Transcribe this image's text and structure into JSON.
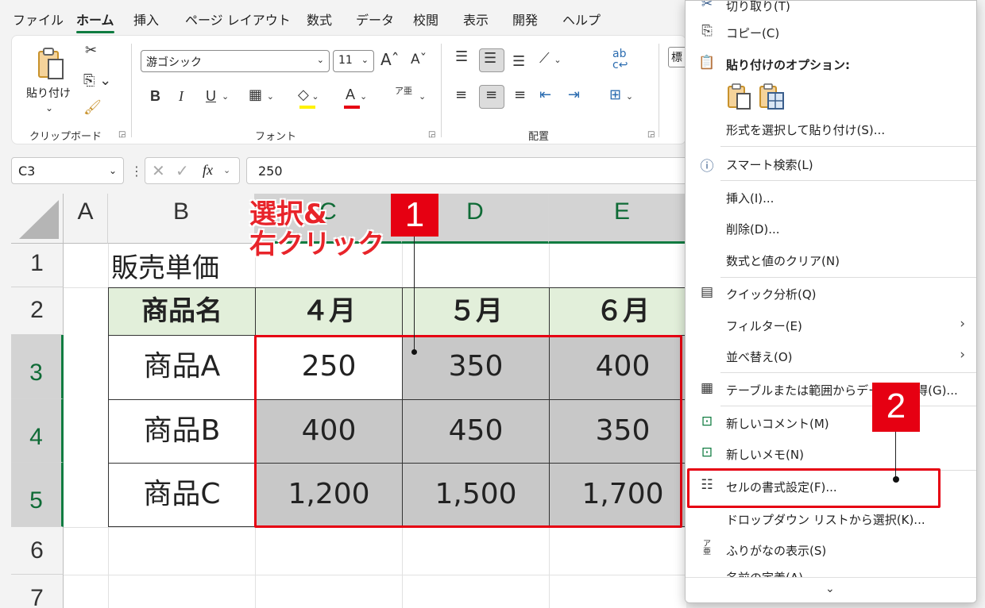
{
  "tabs": [
    "ファイル",
    "ホーム",
    "挿入",
    "ページ レイアウト",
    "数式",
    "データ",
    "校閲",
    "表示",
    "開発",
    "ヘルプ"
  ],
  "ribbon": {
    "paste_label": "貼り付け",
    "clipboard_group": "クリップボード",
    "font_name": "游ゴシック",
    "font_size": "11",
    "font_group": "フォント",
    "align_group": "配置",
    "bold": "B",
    "italic": "I",
    "underline": "U",
    "font_color_letter": "A",
    "furigana_glyph": "ア亜",
    "number_format_partial": "標"
  },
  "formula_bar": {
    "name_box": "C3",
    "fx": "fx",
    "value": "250"
  },
  "grid": {
    "columns": [
      "A",
      "B",
      "C",
      "D",
      "E"
    ],
    "rows": [
      "1",
      "2",
      "3",
      "4",
      "5",
      "6",
      "7"
    ],
    "title": "販売単価",
    "headers": [
      "商品名",
      "４月",
      "５月",
      "６月"
    ],
    "data": [
      [
        "商品A",
        "250",
        "350",
        "400"
      ],
      [
        "商品B",
        "400",
        "450",
        "350"
      ],
      [
        "商品C",
        "1,200",
        "1,500",
        "1,700"
      ]
    ]
  },
  "annotations": {
    "step1_text_line1": "選択&",
    "step1_text_line2": "右クリック",
    "badge1": "1",
    "badge2": "2"
  },
  "context_menu": {
    "cut_partial": "切り取り(T)",
    "copy": "コピー(C)",
    "paste_options": "貼り付けのオプション:",
    "paste_special": "形式を選択して貼り付け(S)...",
    "smart_lookup": "スマート検索(L)",
    "insert": "挿入(I)...",
    "delete": "削除(D)...",
    "clear": "数式と値のクリア(N)",
    "quick_analysis": "クイック分析(Q)",
    "filter": "フィルター(E)",
    "sort": "並べ替え(O)",
    "table_range": "テーブルまたは範囲からデータを取得(G)...",
    "new_comment": "新しいコメント(M)",
    "new_note": "新しいメモ(N)",
    "format_cells": "セルの書式設定(F)...",
    "dropdown": "ドロップダウン リストから選択(K)...",
    "phonetic": "ふりがなの表示(S)",
    "define_name_partial": "名前の定義(A)...",
    "more_icon": "chevron-down"
  },
  "colors": {
    "excel_green": "#107c41",
    "annotation_red": "#e60012",
    "header_fill": "#e2efda",
    "selection_gray": "#c8c8c8"
  }
}
